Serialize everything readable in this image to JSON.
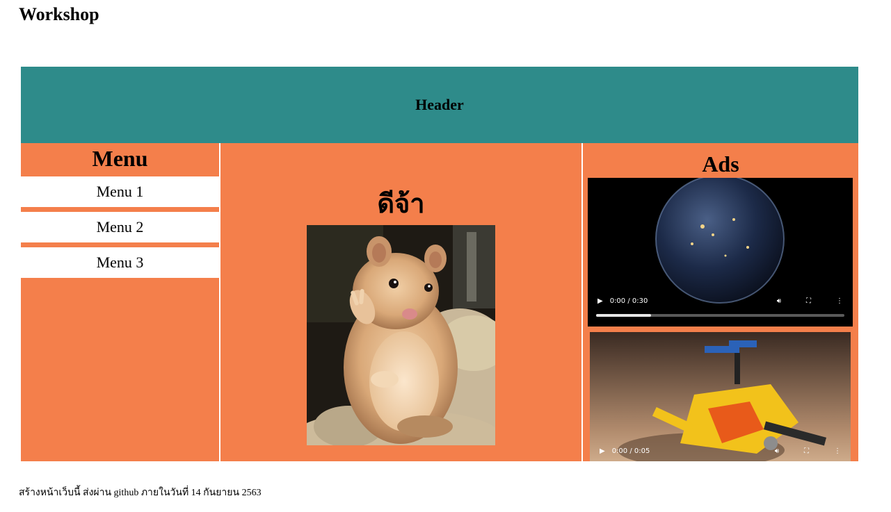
{
  "page": {
    "title": "Workshop",
    "footer": "สร้างหน้าเว็บนี้ ส่งผ่าน github ภายในวันที่ 14 กันยายน 2563"
  },
  "header": {
    "label": "Header"
  },
  "menu": {
    "title": "Menu",
    "items": [
      {
        "label": "Menu 1"
      },
      {
        "label": "Menu 2"
      },
      {
        "label": "Menu 3"
      }
    ]
  },
  "content": {
    "greeting": "ดีจ้า",
    "image": "hamster-photo"
  },
  "ads": {
    "title": "Ads",
    "videos": [
      {
        "time": "0:00 / 0:30",
        "thumbnail": "earth-at-night",
        "progress": 0.22
      },
      {
        "time": "0:00 / 0:05",
        "thumbnail": "lego-helicopter",
        "progress": 0.0
      }
    ]
  },
  "colors": {
    "header_bg": "#2e8b8a",
    "panel_bg": "#f47f4b",
    "menu_item_bg": "#ffffff"
  }
}
